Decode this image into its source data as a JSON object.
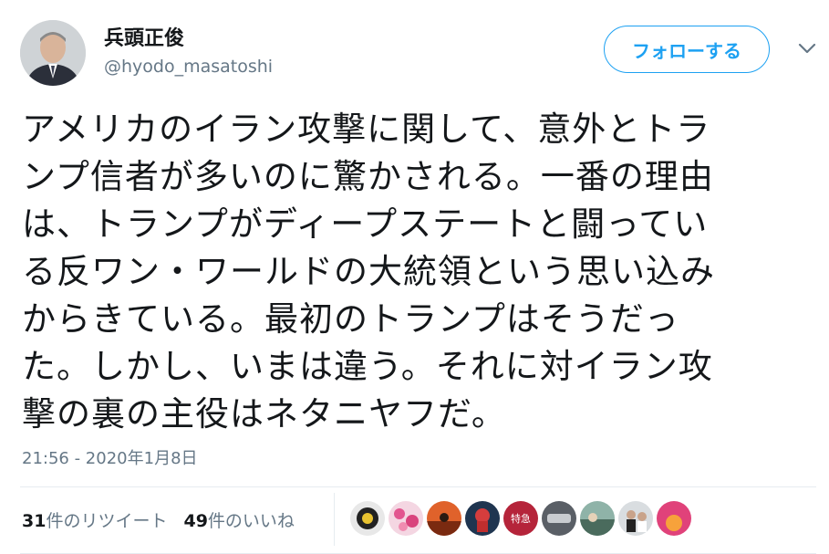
{
  "user": {
    "display_name": "兵頭正俊",
    "handle": "@hyodo_masatoshi",
    "avatar_icon": "profile-photo"
  },
  "follow_button": {
    "label": "フォローする"
  },
  "menu": {
    "icon": "chevron-down-icon"
  },
  "tweet": {
    "text": "アメリカのイラン攻撃に関して、意外とトラ\nンプ信者が多いのに驚かされる。一番の理由\nは、トランプがディープステートと闘ってい\nる反ワン・ワールドの大統領という思い込み\nからきている。最初のトランプはそうだっ\nた。しかし、いまは違う。それに対イラン攻\n撃の裏の主役はネタニヤフだ。",
    "timestamp": "21:56 - 2020年1月8日"
  },
  "stats": {
    "retweets_count": "31",
    "retweets_label": "件のリツイート",
    "likes_count": "49",
    "likes_label": "件のいいね"
  },
  "likers_badge_text": "特急",
  "colors": {
    "accent": "#1da1f2",
    "text_primary": "#14171a",
    "text_secondary": "#657786",
    "divider": "#e6ecf0"
  }
}
